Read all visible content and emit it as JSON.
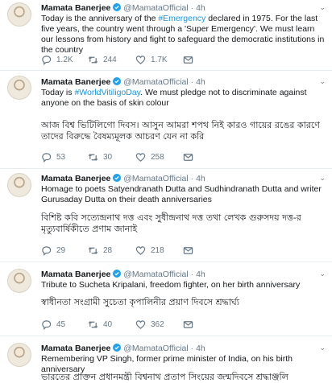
{
  "tweets": [
    {
      "author": "Mamata Banerjee",
      "verified": true,
      "handle": "@MamataOfficial",
      "sep": "·",
      "time": "4h",
      "text_before": "Today is the anniversary of the ",
      "hashtag": "#Emergency",
      "text_after": " declared in 1975. For the last five years, the country went through a 'Super Emergency'. We must learn our lessons from history and fight to safeguard the democratic institutions in the country",
      "bengali": "",
      "replies": "1.2K",
      "retweets": "244",
      "likes": "1.7K"
    },
    {
      "author": "Mamata Banerjee",
      "verified": true,
      "handle": "@MamataOfficial",
      "sep": "·",
      "time": "4h",
      "text_before": "Today is ",
      "hashtag": "#WorldVitiligoDay",
      "text_after": ". We must pledge not to discriminate against anyone on the basis of skin colour",
      "bengali": "আজ বিশ্ব ভিটিলিগো দিবস। আসুন আমরা শপথ নিই কারও গায়ের রঙের কারণে তাদের বিরুদ্ধে বৈষম্যমূলক আচরণ যেন না করি",
      "replies": "53",
      "retweets": "30",
      "likes": "258"
    },
    {
      "author": "Mamata Banerjee",
      "verified": true,
      "handle": "@MamataOfficial",
      "sep": "·",
      "time": "4h",
      "text_before": "Homage to poets Satyendranath Dutta and Sudhindranath Dutta and writer Gurusaday Dutta on their death anniversaries",
      "hashtag": "",
      "text_after": "",
      "bengali": "বিশিষ্ট কবি সত্যেন্দ্রনাথ দত্ত এবং সুধীন্দ্রনাথ দত্ত তথা লেখক গুরুসদয় দত্ত-র মৃত্যুবার্ষিকীতে প্রণাম জানাই",
      "replies": "29",
      "retweets": "28",
      "likes": "218"
    },
    {
      "author": "Mamata Banerjee",
      "verified": true,
      "handle": "@MamataOfficial",
      "sep": "·",
      "time": "4h",
      "text_before": "Tribute to Sucheta Kripalani, freedom fighter, on her birth anniversary",
      "hashtag": "",
      "text_after": "",
      "bengali": "স্বাধীনতা সংগ্রামী সুচেতা কৃপালিনীর প্রয়াণ দিবসে শ্রদ্ধার্ঘ্য",
      "replies": "45",
      "retweets": "40",
      "likes": "362"
    },
    {
      "author": "Mamata Banerjee",
      "verified": true,
      "handle": "@MamataOfficial",
      "sep": "·",
      "time": "4h",
      "text_before": "Remembering VP Singh, former prime minister of India, on his birth anniversary",
      "hashtag": "",
      "text_after": "",
      "bengali": "ভারতের প্রাক্তন প্রধানমন্ত্রী বিশ্বনাথ প্রতাপ সিংয়ের জন্মদিবসে শ্রদ্ধাঞ্জলি",
      "replies": "",
      "retweets": "",
      "likes": ""
    }
  ]
}
